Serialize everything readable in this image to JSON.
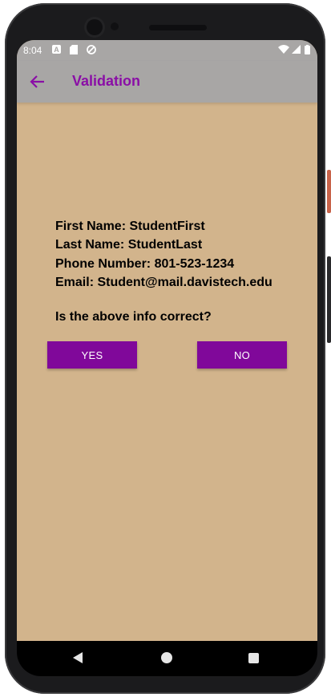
{
  "status_bar": {
    "time": "8:04",
    "icons": [
      "notification-a-icon",
      "sd-card-icon",
      "sync-icon",
      "wifi-icon",
      "signal-icon",
      "battery-icon"
    ]
  },
  "app_bar": {
    "title": "Validation",
    "back_icon": "arrow-left-icon"
  },
  "content": {
    "info_lines": [
      "First Name: StudentFirst",
      "Last Name: StudentLast",
      "Phone Number: 801-523-1234",
      "Email: Student@mail.davistech.edu"
    ],
    "question": "Is the above info correct?"
  },
  "buttons": {
    "yes_label": "YES",
    "no_label": "NO"
  },
  "colors": {
    "background": "#d2b48c",
    "app_bar": "#a8a6a5",
    "accent": "#8a0ea6",
    "button": "#80089a"
  }
}
